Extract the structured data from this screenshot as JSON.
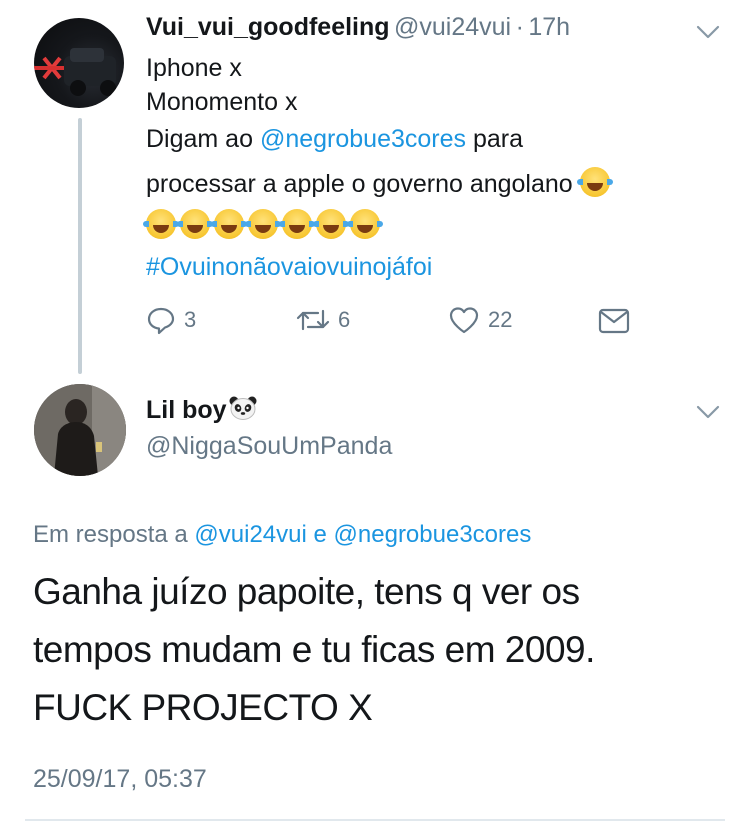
{
  "tweet1": {
    "display_name": "Vui_vui_goodfeeling",
    "handle": "@vui24vui",
    "separator": "·",
    "time": "17h",
    "line1": "Iphone x",
    "line2": "Monomento x",
    "line3_prefix": "Digam ao",
    "line3_mention": "@negrobue3cores",
    "line3_suffix": "para",
    "line4": "processar a apple o governo angolano",
    "emoji_name": "face-with-tears-of-joy",
    "emoji_row_count": 7,
    "hashtag": "#Ovuinonãovaiovuinojáfoi",
    "replies": "3",
    "retweets": "6",
    "likes": "22"
  },
  "tweet2": {
    "display_name": "Lil boy",
    "name_emoji": "panda-face",
    "handle": "@NiggaSouUmPanda",
    "reply_to_prefix": "Em resposta a",
    "reply_to_user1": "@vui24vui",
    "reply_to_and": "e",
    "reply_to_user2": "@negrobue3cores",
    "text_line1": "Ganha juízo papoite, tens q ver os",
    "text_line2": "tempos mudam e tu ficas em 2009.",
    "text_line3": "FUCK PROJECTO X",
    "timestamp": "25/09/17, 05:37"
  },
  "colors": {
    "link": "#1b95e0",
    "secondary_text": "#657786",
    "thread_line": "#c4cfd6"
  }
}
